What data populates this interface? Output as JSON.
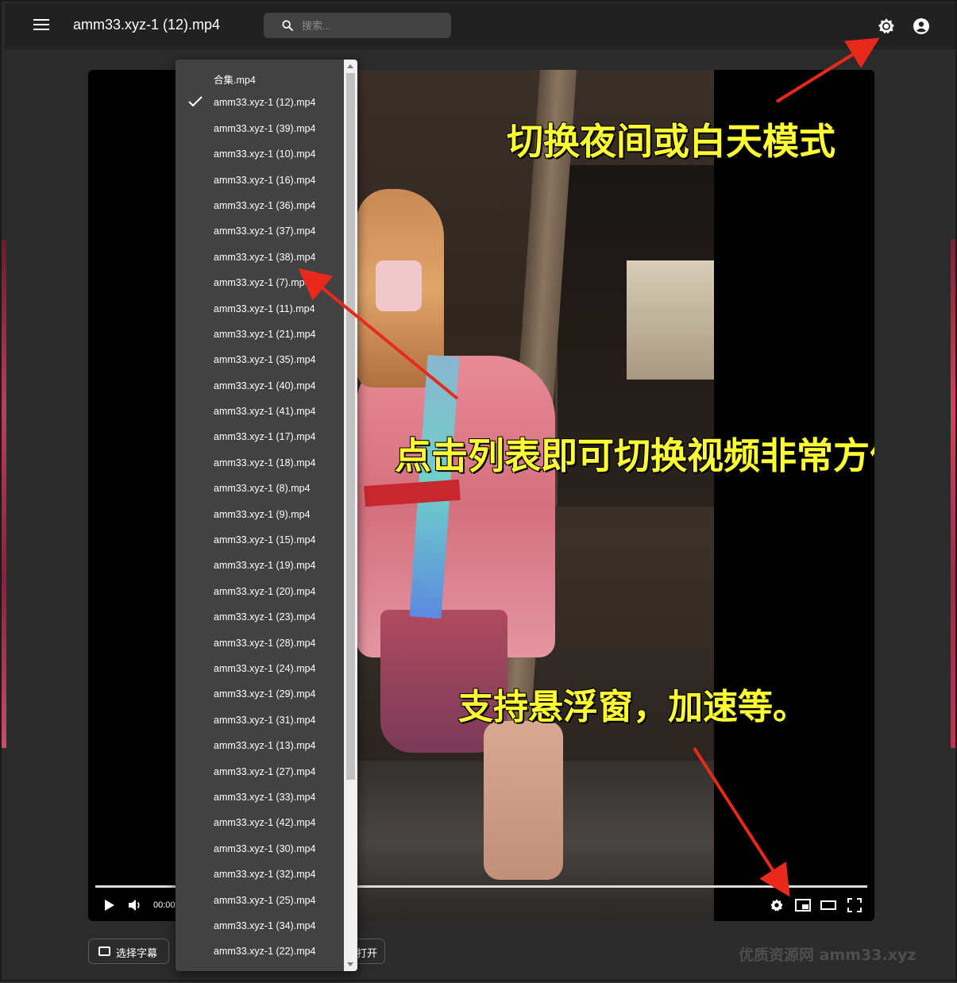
{
  "colors": {
    "appbar": "#212121",
    "background": "#2b2b2b",
    "menu": "#424242",
    "annotation_text": "#ffff33",
    "annotation_arrow": "#e8291c"
  },
  "header": {
    "menu_icon": "hamburger-menu-icon",
    "title": "amm33.xyz-1 (12).mp4",
    "search_placeholder": "搜索...",
    "theme_icon": "brightness-icon",
    "account_icon": "account-circle-icon"
  },
  "playlist": {
    "selected_index": 1,
    "items": [
      "合集.mp4",
      "amm33.xyz-1 (12).mp4",
      "amm33.xyz-1 (39).mp4",
      "amm33.xyz-1 (10).mp4",
      "amm33.xyz-1 (16).mp4",
      "amm33.xyz-1 (36).mp4",
      "amm33.xyz-1 (37).mp4",
      "amm33.xyz-1 (38).mp4",
      "amm33.xyz-1 (7).mp4",
      "amm33.xyz-1 (11).mp4",
      "amm33.xyz-1 (21).mp4",
      "amm33.xyz-1 (35).mp4",
      "amm33.xyz-1 (40).mp4",
      "amm33.xyz-1 (41).mp4",
      "amm33.xyz-1 (17).mp4",
      "amm33.xyz-1 (18).mp4",
      "amm33.xyz-1 (8).mp4",
      "amm33.xyz-1 (9).mp4",
      "amm33.xyz-1 (15).mp4",
      "amm33.xyz-1 (19).mp4",
      "amm33.xyz-1 (20).mp4",
      "amm33.xyz-1 (23).mp4",
      "amm33.xyz-1 (28).mp4",
      "amm33.xyz-1 (24).mp4",
      "amm33.xyz-1 (29).mp4",
      "amm33.xyz-1 (31).mp4",
      "amm33.xyz-1 (13).mp4",
      "amm33.xyz-1 (27).mp4",
      "amm33.xyz-1 (33).mp4",
      "amm33.xyz-1 (42).mp4",
      "amm33.xyz-1 (30).mp4",
      "amm33.xyz-1 (32).mp4",
      "amm33.xyz-1 (25).mp4",
      "amm33.xyz-1 (34).mp4",
      "amm33.xyz-1 (22).mp4"
    ]
  },
  "player": {
    "time": "00:00",
    "progress": 0,
    "icons": [
      "play-icon",
      "volume-icon",
      "settings-icon",
      "picture-in-picture-icon",
      "theater-mode-icon",
      "fullscreen-icon"
    ]
  },
  "annotations": {
    "theme_hint": "切换夜间或白天模式",
    "playlist_hint": "点击列表即可切换视频非常方便",
    "features_hint": "支持悬浮窗，加速等。"
  },
  "footer": {
    "subtitle_button": "选择字幕",
    "open_button_partial": "打开",
    "watermark": "优质资源网  amm33.xyz"
  }
}
